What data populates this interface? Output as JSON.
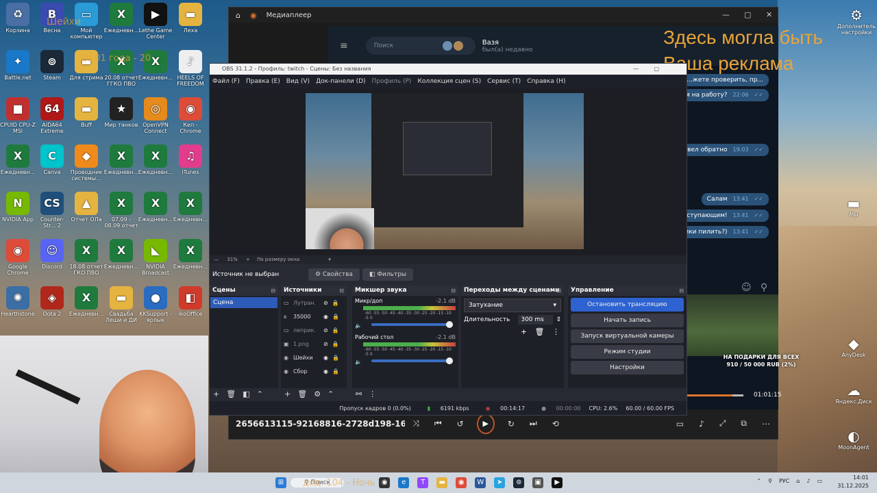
{
  "desktop": {
    "icons": [
      {
        "label": "Корзина",
        "glyph": "♻",
        "color": "#4a6fa5"
      },
      {
        "label": "Весна",
        "glyph": "В",
        "color": "#3a4bb0"
      },
      {
        "label": "Мой компьютер",
        "glyph": "▭",
        "color": "#2a9bd6"
      },
      {
        "label": "Ежедневн...",
        "glyph": "X",
        "color": "#1f7a3e"
      },
      {
        "label": "Lethe Game Center",
        "glyph": "▶",
        "color": "#111"
      },
      {
        "label": "Леха",
        "glyph": "▬",
        "color": "#e5b440"
      },
      {
        "label": "Battle.net",
        "glyph": "✦",
        "color": "#1a78c8"
      },
      {
        "label": "Steam",
        "glyph": "⊚",
        "color": "#1b2838"
      },
      {
        "label": "Для стрима",
        "glyph": "▬",
        "color": "#e5b440"
      },
      {
        "label": "20.08 отчет ГГКО ПВО",
        "glyph": "X",
        "color": "#1f7a3e"
      },
      {
        "label": "Ежедневн...",
        "glyph": "X",
        "color": "#1f7a3e"
      },
      {
        "label": "HEELS OF FREEDOM 2...",
        "glyph": "♪",
        "color": "#eee"
      },
      {
        "label": "CPUID CPU-Z MSI",
        "glyph": "■",
        "color": "#c03030"
      },
      {
        "label": "AIDA64 Extreme",
        "glyph": "64",
        "color": "#b01818"
      },
      {
        "label": "Buff",
        "glyph": "▬",
        "color": "#e5b440"
      },
      {
        "label": "Мир танков",
        "glyph": "★",
        "color": "#222"
      },
      {
        "label": "OpenVPN Connect",
        "glyph": "◎",
        "color": "#e58a1c"
      },
      {
        "label": "Кеп - Chrome",
        "glyph": "◉",
        "color": "#dd4b39"
      },
      {
        "label": "Ежедневн...",
        "glyph": "X",
        "color": "#1f7a3e"
      },
      {
        "label": "Canva",
        "glyph": "C",
        "color": "#00c4cc"
      },
      {
        "label": "Проводник системы...",
        "glyph": "◆",
        "color": "#f08a1c"
      },
      {
        "label": "Ежедневн...",
        "glyph": "X",
        "color": "#1f7a3e"
      },
      {
        "label": "Ежедневн...",
        "glyph": "X",
        "color": "#1f7a3e"
      },
      {
        "label": "iTunes",
        "glyph": "♫",
        "color": "#e23d8c"
      },
      {
        "label": "NVIDIA App",
        "glyph": "N",
        "color": "#76b900"
      },
      {
        "label": "Counter-Str... 2",
        "glyph": "CS",
        "color": "#1f4f7a"
      },
      {
        "label": "Отчет ОЛа",
        "glyph": "▲",
        "color": "#e5b440"
      },
      {
        "label": "07.09 - 08.09 отчет ГКО...",
        "glyph": "X",
        "color": "#1f7a3e"
      },
      {
        "label": "Ежедневн...",
        "glyph": "X",
        "color": "#1f7a3e"
      },
      {
        "label": "Ежедневн...",
        "glyph": "X",
        "color": "#1f7a3e"
      },
      {
        "label": "Google Chrome",
        "glyph": "◉",
        "color": "#dd4b39"
      },
      {
        "label": "Discord",
        "glyph": "☺",
        "color": "#5865f2"
      },
      {
        "label": "18.08 отчет ГКО ПВО",
        "glyph": "X",
        "color": "#1f7a3e"
      },
      {
        "label": "Ежедневн...",
        "glyph": "X",
        "color": "#1f7a3e"
      },
      {
        "label": "NVIDIA Broadcast",
        "glyph": "◣",
        "color": "#76b900"
      },
      {
        "label": "Ежедневн...",
        "glyph": "X",
        "color": "#1f7a3e"
      },
      {
        "label": "Hearthstone",
        "glyph": "✺",
        "color": "#3a6ea5"
      },
      {
        "label": "Dota 2",
        "glyph": "◈",
        "color": "#b0281c"
      },
      {
        "label": "Ежедневн...",
        "glyph": "X",
        "color": "#1f7a3e"
      },
      {
        "label": "Свадьба Леши и ДИ",
        "glyph": "▬",
        "color": "#e5b440"
      },
      {
        "label": "KKSupport - ярлык",
        "glyph": "●",
        "color": "#2a6cc0"
      },
      {
        "label": "ikoOffice",
        "glyph": "◧",
        "color": "#d03a2a"
      }
    ],
    "right_icons": [
      {
        "label": "Дополнительные настройки",
        "glyph": "⚙"
      },
      {
        "label": "Мы",
        "glyph": "▬"
      },
      {
        "label": "AnyDesk",
        "glyph": "◆"
      },
      {
        "label": "Яндекс.Диск",
        "glyph": "☁"
      },
      {
        "label": "MoonAgent",
        "glyph": "◐"
      }
    ]
  },
  "overlay_text": {
    "top_left": "Шейхи",
    "mid_left": "До 01 года - 20",
    "taskbar": "дод: 104 - Ночь"
  },
  "ad": {
    "line1": "Здесь могла быть",
    "line2": "Ваша реклама"
  },
  "media_player": {
    "title": "Медиаплеер",
    "file": "2656613115-92168816-2728d198-16e1-4cda-...",
    "time": "01:01:15"
  },
  "telegram": {
    "search_placeholder": "Поиск",
    "contact_name": "Вазя",
    "contact_status": "был(а) недавно",
    "messages": [
      {
        "text": "...жете проверить, пр...",
        "time": ""
      },
      {
        "text": "ился на работу?",
        "time": "22:06"
      },
      {
        "text": "большое перевел обратно",
        "time": "19:03"
      },
      {
        "text": "Салам",
        "time": "13:41"
      },
      {
        "text": "с наступающим!",
        "time": "13:41"
      },
      {
        "text": "ролики пилить?)",
        "time": "13:41"
      }
    ]
  },
  "obs": {
    "title": "OBS 31.1.2 - Профиль: twitch - Сцены: Без названия",
    "menu": [
      {
        "label": "Файл (F)",
        "dim": false
      },
      {
        "label": "Правка (E)",
        "dim": false
      },
      {
        "label": "Вид (V)",
        "dim": false
      },
      {
        "label": "Док-панели (D)",
        "dim": false
      },
      {
        "label": "Профиль (P)",
        "dim": true
      },
      {
        "label": "Коллекция сцен (S)",
        "dim": false
      },
      {
        "label": "Сервис (T)",
        "dim": false
      },
      {
        "label": "Справка (H)",
        "dim": false
      }
    ],
    "zoom": "31%",
    "zoom_mode": "По размеру окна",
    "no_source": "Источник не выбран",
    "properties": "Свойства",
    "filters": "Фильтры",
    "scenes_title": "Сцены",
    "scene": "Сцена",
    "sources_title": "Источники",
    "sources": [
      {
        "name": "Лутран.",
        "dim": true,
        "glyph": "▭",
        "visible": false
      },
      {
        "name": "35000",
        "dim": false,
        "glyph": "ꞩ",
        "visible": true
      },
      {
        "name": "леприк.",
        "dim": true,
        "glyph": "▭",
        "visible": false
      },
      {
        "name": "1.png",
        "dim": true,
        "glyph": "▣",
        "visible": false
      },
      {
        "name": "Шейхи",
        "dim": false,
        "glyph": "◉",
        "visible": true
      },
      {
        "name": "Сбор",
        "dim": false,
        "glyph": "◉",
        "visible": true
      }
    ],
    "mixer_title": "Микшер звука",
    "mixer": [
      {
        "name": "Микр/доп",
        "db": "-2.1 dB"
      },
      {
        "name": "Рабочий стол",
        "db": "-2.1 dB"
      }
    ],
    "meter_ticks": "-60 -55 -50 -45 -40 -35 -30 -25 -20 -15 -10 -5 0",
    "transitions_title": "Переходы между сценами",
    "transition": "Затухание",
    "duration_label": "Длительность",
    "duration": "300 ms",
    "controls_title": "Управление",
    "controls": [
      {
        "label": "Остановить трансляцию",
        "active": true
      },
      {
        "label": "Начать запись",
        "active": false
      },
      {
        "label": "Запуск виртуальной камеры",
        "active": false
      },
      {
        "label": "Режим студии",
        "active": false
      },
      {
        "label": "Настройки",
        "active": false
      }
    ],
    "status": {
      "dropped": "Пропуск кадров 0 (0.0%)",
      "bitrate": "6191 kbps",
      "stream_time": "00:14:17",
      "rec_time": "00:00:00",
      "cpu": "CPU: 2.6%",
      "fps": "60.00 / 60.00 FPS"
    }
  },
  "donation": {
    "line1": "НА ПОДАРКИ ДЛЯ ВСЕХ",
    "line2": "910 / 50 000 RUB (2%)",
    "progress": 0.02
  },
  "taskbar": {
    "search": "Поиск",
    "lang": "РУС",
    "time": "14:01",
    "date": "31.12.2025"
  }
}
